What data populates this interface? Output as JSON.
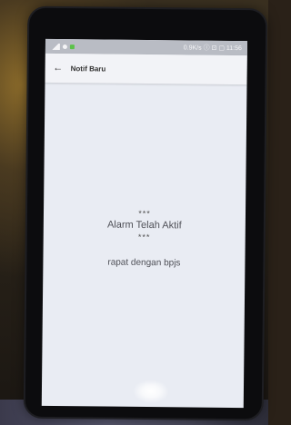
{
  "status_bar": {
    "left_icons": [
      "signal-icon",
      "notification-icon",
      "app-icon"
    ],
    "right_text": "0.9K/s ⓘ ⊡ ▢ 11:56"
  },
  "app_bar": {
    "back_icon": "arrow-left-icon",
    "title": "Notif Baru"
  },
  "notification": {
    "stars_top": "***",
    "status": "Alarm Telah Aktif",
    "stars_bottom": "***",
    "message": "rapat dengan bpjs"
  },
  "colors": {
    "screen_bg": "#e9ecf3",
    "status_bar": "#b9bcc4",
    "app_bar": "#f2f3f7"
  }
}
